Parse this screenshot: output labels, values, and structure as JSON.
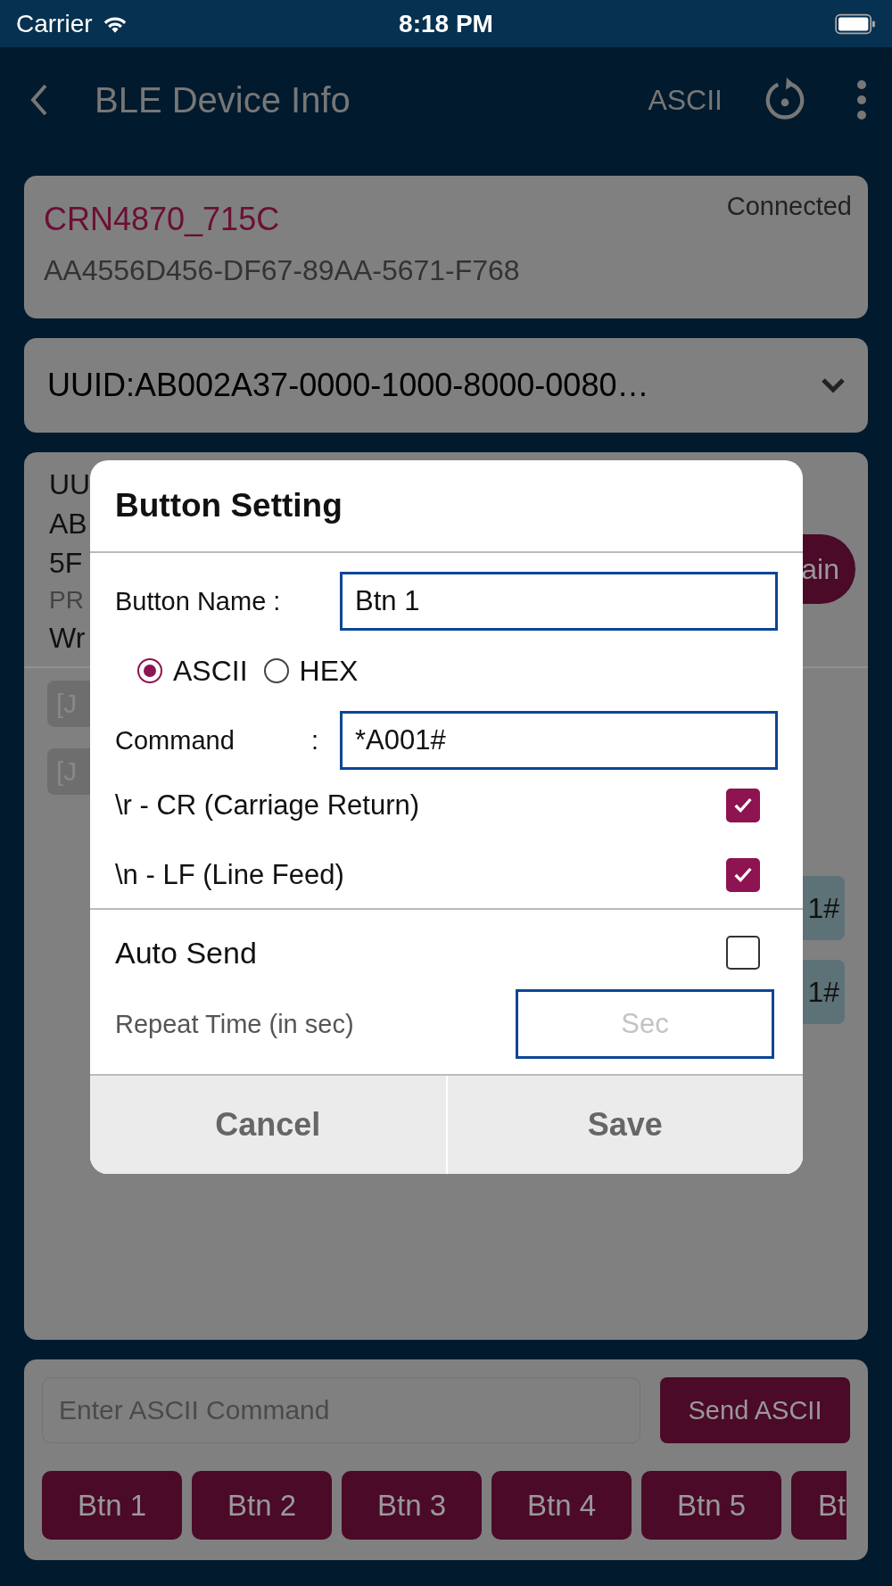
{
  "status_bar": {
    "carrier": "Carrier",
    "time": "8:18 PM"
  },
  "nav": {
    "title": "BLE Device Info",
    "mode": "ASCII"
  },
  "device": {
    "name": "CRN4870_715C",
    "address": "AA4556D456-DF67-89AA-5671-F768",
    "status": "Connected"
  },
  "service_select": {
    "value": "UUID:AB002A37-0000-1000-8000-0080…"
  },
  "characteristic": {
    "lines": [
      {
        "text": "UU",
        "kind": "value"
      },
      {
        "text": "AB",
        "kind": "value"
      },
      {
        "text": "5F",
        "kind": "value"
      },
      {
        "text": "PR",
        "kind": "label"
      },
      {
        "text": "Wr",
        "kind": "value"
      }
    ],
    "button": "ain",
    "log_left": [
      "[J",
      "[J"
    ],
    "log_right": [
      "1#",
      "1#"
    ]
  },
  "command_bar": {
    "placeholder": "Enter ASCII Command",
    "send": "Send ASCII",
    "buttons": [
      "Btn 1",
      "Btn 2",
      "Btn 3",
      "Btn 4",
      "Btn 5",
      "Bt"
    ]
  },
  "dialog": {
    "title": "Button Setting",
    "name_label": "Button Name :",
    "name_value": "Btn 1",
    "formats": [
      {
        "label": "ASCII",
        "selected": true
      },
      {
        "label": "HEX",
        "selected": false
      }
    ],
    "command_label": "Command",
    "command_colon": ":",
    "command_value": "*A001#",
    "options": [
      {
        "label": "\\r - CR (Carriage Return)",
        "checked": true
      },
      {
        "label": "\\n - LF (Line Feed)",
        "checked": true
      }
    ],
    "auto_send": {
      "label": "Auto Send",
      "checked": false
    },
    "repeat": {
      "label": "Repeat Time (in sec)",
      "placeholder": "Sec"
    },
    "actions": [
      "Cancel",
      "Save"
    ]
  }
}
